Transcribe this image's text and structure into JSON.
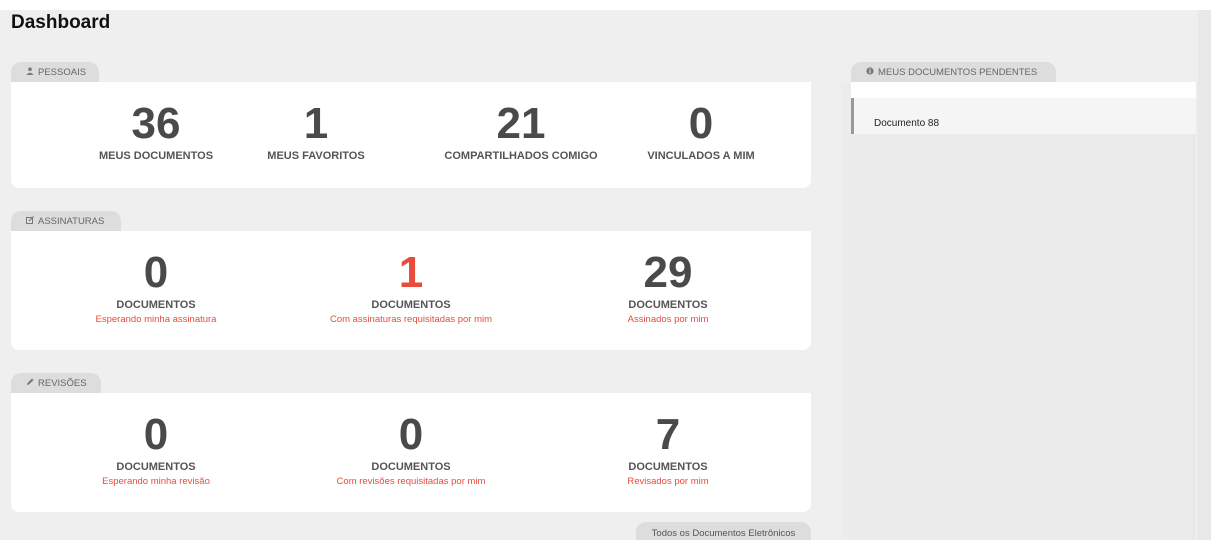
{
  "page": {
    "title": "Dashboard"
  },
  "pessoais": {
    "tab_label": "PESSOAIS",
    "stats": [
      {
        "value": "36",
        "label": "MEUS DOCUMENTOS"
      },
      {
        "value": "1",
        "label": "MEUS FAVORITOS"
      },
      {
        "value": "21",
        "label": "COMPARTILHADOS COMIGO"
      },
      {
        "value": "0",
        "label": "VINCULADOS A MIM"
      }
    ]
  },
  "assinaturas": {
    "tab_label": "ASSINATURAS",
    "stats": [
      {
        "value": "0",
        "label": "DOCUMENTOS",
        "sub": "Esperando minha assinatura"
      },
      {
        "value": "1",
        "label": "DOCUMENTOS",
        "sub": "Com assinaturas requisitadas por mim"
      },
      {
        "value": "29",
        "label": "DOCUMENTOS",
        "sub": "Assinados por mim"
      }
    ]
  },
  "revisoes": {
    "tab_label": "REVISÕES",
    "stats": [
      {
        "value": "0",
        "label": "DOCUMENTOS",
        "sub": "Esperando minha revisão"
      },
      {
        "value": "0",
        "label": "DOCUMENTOS",
        "sub": "Com revisões requisitadas por mim"
      },
      {
        "value": "7",
        "label": "DOCUMENTOS",
        "sub": "Revisados por mim"
      }
    ]
  },
  "pendentes": {
    "tab_label": "MEUS DOCUMENTOS PENDENTES",
    "items": [
      {
        "label": "Documento 88"
      }
    ]
  },
  "footer": {
    "link_label": "Todos os Documentos Eletrônicos"
  },
  "colors": {
    "accent_red": "#e74c3c",
    "card_bg": "#ffffff",
    "page_bg": "#efefef"
  },
  "icons": {
    "pessoais": "user-icon",
    "assinaturas": "edit-icon",
    "revisoes": "pencil-icon",
    "pendentes": "info-circle-icon"
  }
}
